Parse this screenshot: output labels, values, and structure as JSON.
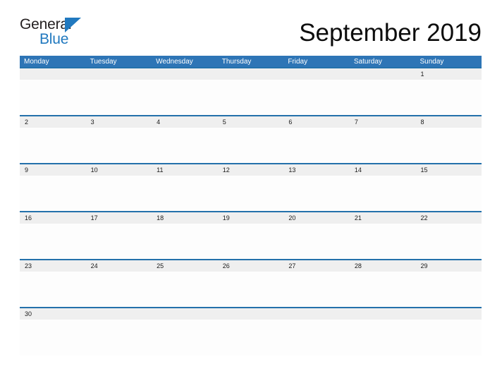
{
  "brand": {
    "logo_text_top": "General",
    "logo_text_bottom": "Blue",
    "logo_triangle_icon": "triangle-icon",
    "color_dark": "#231f20",
    "color_blue": "#2179bf"
  },
  "header": {
    "title": "September 2019"
  },
  "calendar": {
    "month": "September",
    "year": "2019",
    "header_bg": "#2e75b6",
    "header_text_color": "#ffffff",
    "row_divider_color": "#2471ab",
    "date_band_bg": "#efefef",
    "weekdays": [
      "Monday",
      "Tuesday",
      "Wednesday",
      "Thursday",
      "Friday",
      "Saturday",
      "Sunday"
    ],
    "weeks": [
      {
        "days": [
          "",
          "",
          "",
          "",
          "",
          "",
          "1"
        ]
      },
      {
        "days": [
          "2",
          "3",
          "4",
          "5",
          "6",
          "7",
          "8"
        ]
      },
      {
        "days": [
          "9",
          "10",
          "11",
          "12",
          "13",
          "14",
          "15"
        ]
      },
      {
        "days": [
          "16",
          "17",
          "18",
          "19",
          "20",
          "21",
          "22"
        ]
      },
      {
        "days": [
          "23",
          "24",
          "25",
          "26",
          "27",
          "28",
          "29"
        ]
      },
      {
        "days": [
          "30",
          "",
          "",
          "",
          "",
          "",
          ""
        ]
      }
    ]
  }
}
